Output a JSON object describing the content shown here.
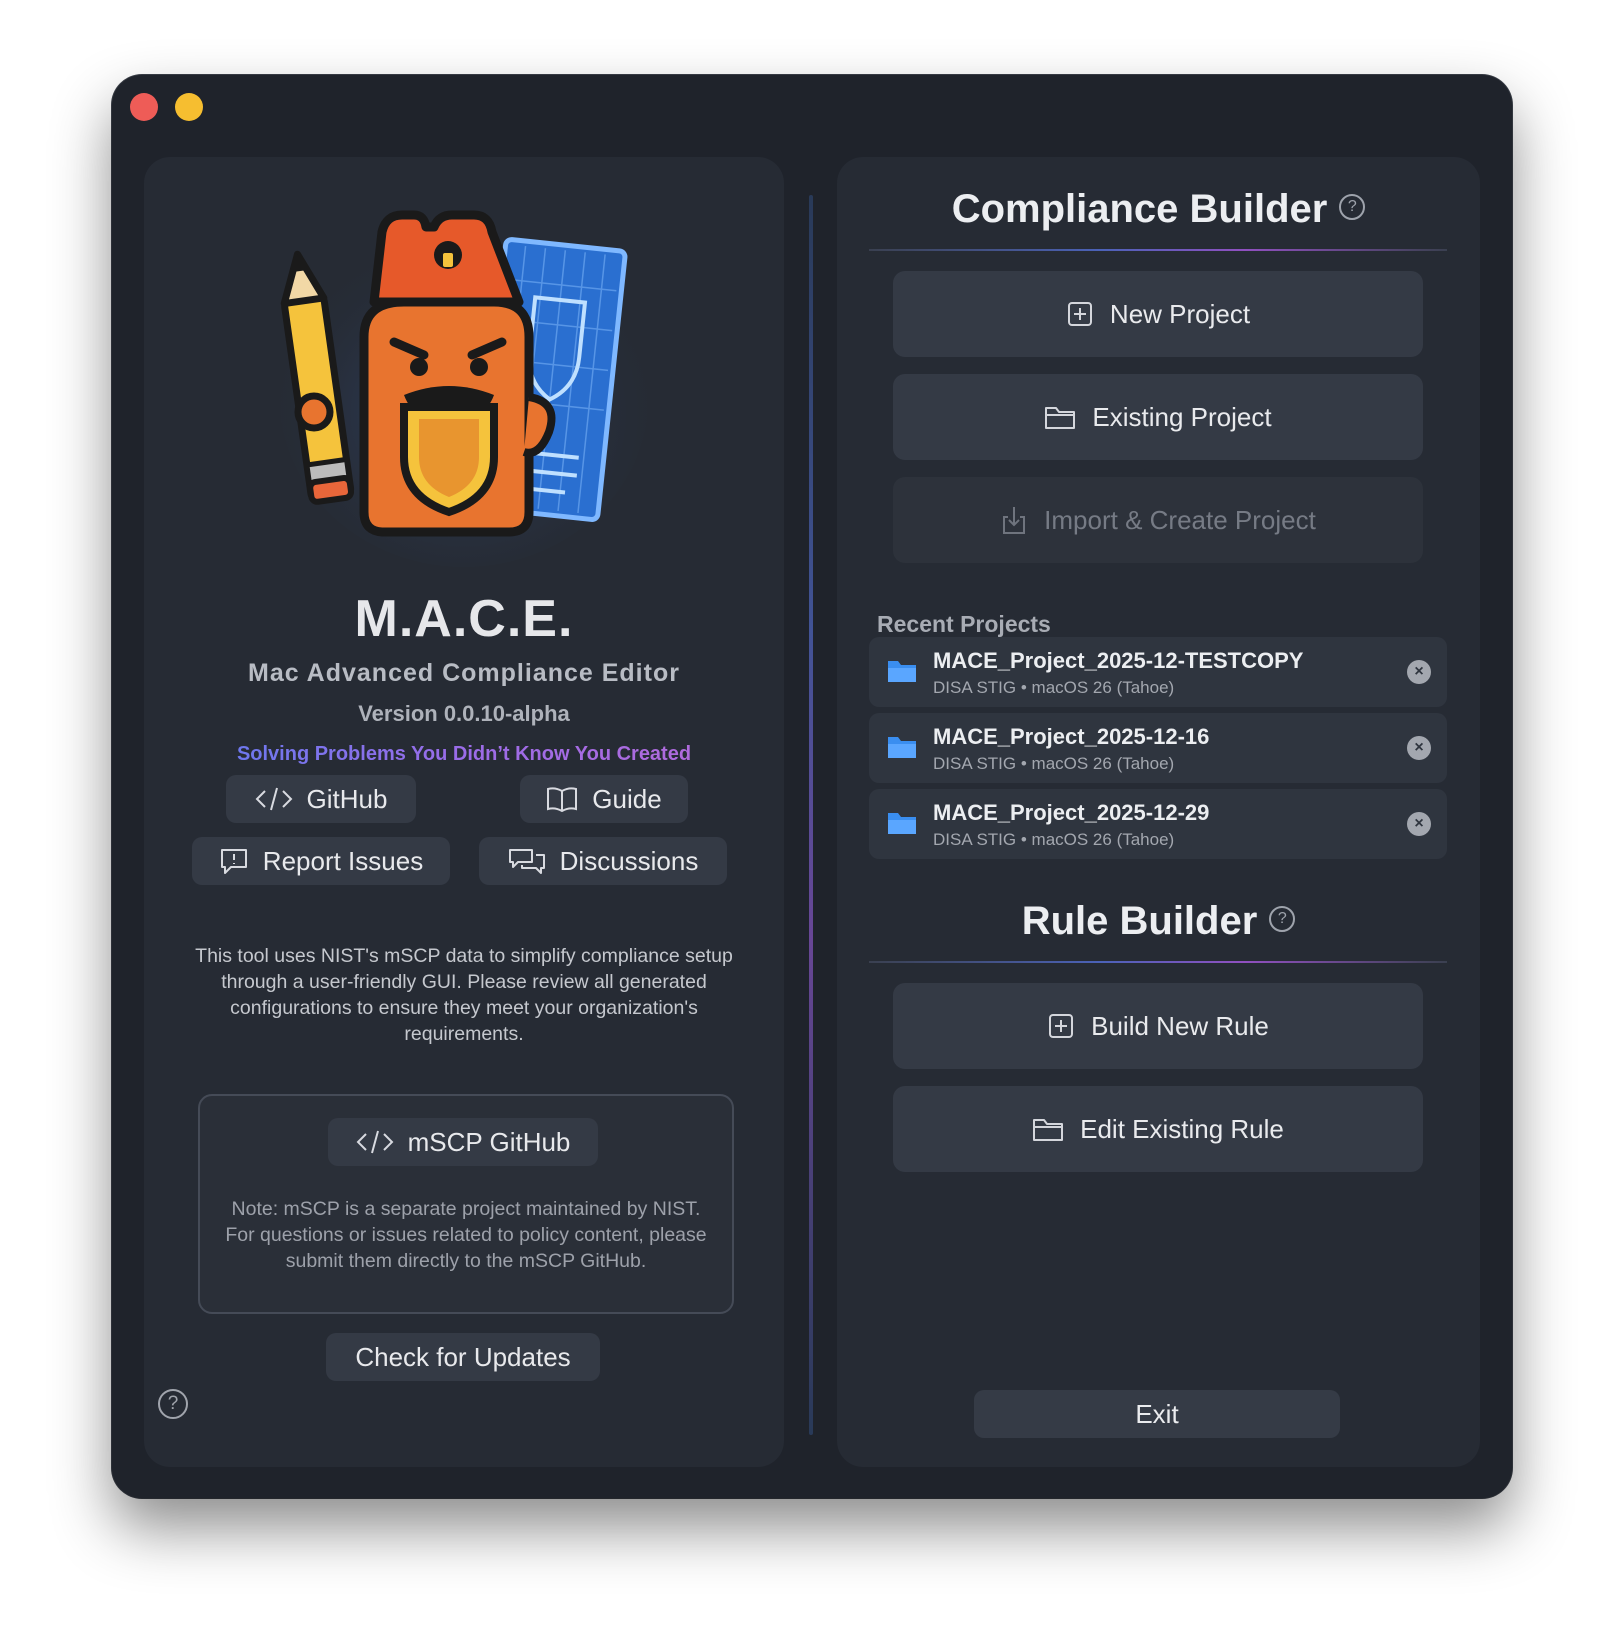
{
  "window": {
    "traffic_lights": [
      "close",
      "minimize"
    ],
    "colors": {
      "close": "#ee5c57",
      "minimize": "#f6be30",
      "background": "#1f232b",
      "panel": "#262b34"
    }
  },
  "left": {
    "app_name": "M.A.C.E.",
    "app_subtitle": "Mac Advanced Compliance Editor",
    "version": "Version 0.0.10-alpha",
    "tagline": "Solving Problems You Didn’t Know You Created",
    "links": {
      "github": "GitHub",
      "guide": "Guide",
      "report_issues": "Report Issues",
      "discussions": "Discussions"
    },
    "description": "This tool uses NIST's mSCP data to simplify compliance setup through a user-friendly GUI. Please review all generated configurations to ensure they meet your organization's requirements.",
    "mscp_button": "mSCP GitHub",
    "mscp_note": "Note: mSCP is a separate project maintained by NIST. For questions or issues related to policy content, please submit them directly to the mSCP GitHub.",
    "check_updates": "Check for Updates",
    "help_symbol": "?"
  },
  "compliance": {
    "title": "Compliance Builder",
    "help_symbol": "?",
    "new_project": "New Project",
    "existing_project": "Existing Project",
    "import_project": "Import & Create Project",
    "recent_label": "Recent Projects",
    "recent": [
      {
        "name": "MACE_Project_2025-12-TESTCOPY",
        "meta": "DISA STIG • macOS 26 (Tahoe)"
      },
      {
        "name": "MACE_Project_2025-12-16",
        "meta": "DISA STIG • macOS 26 (Tahoe)"
      },
      {
        "name": "MACE_Project_2025-12-29",
        "meta": "DISA STIG • macOS 26 (Tahoe)"
      }
    ],
    "close_symbol": "×",
    "folder_color": "#3a8ef0"
  },
  "rule": {
    "title": "Rule Builder",
    "help_symbol": "?",
    "build_new": "Build New Rule",
    "edit_existing": "Edit Existing Rule"
  },
  "exit": "Exit",
  "icons": [
    "code-icon",
    "book-icon",
    "report-icon",
    "discussions-icon",
    "plus-square-icon",
    "folder-icon",
    "import-icon",
    "help-icon",
    "close-icon",
    "mascot-logo"
  ]
}
